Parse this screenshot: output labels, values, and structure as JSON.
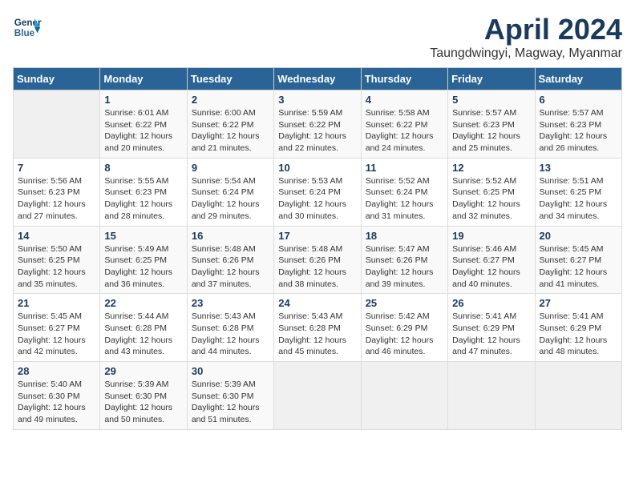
{
  "header": {
    "logo_line1": "General",
    "logo_line2": "Blue",
    "month_title": "April 2024",
    "subtitle": "Taungdwingyi, Magway, Myanmar"
  },
  "calendar": {
    "days_of_week": [
      "Sunday",
      "Monday",
      "Tuesday",
      "Wednesday",
      "Thursday",
      "Friday",
      "Saturday"
    ],
    "weeks": [
      [
        {
          "day": "",
          "info": ""
        },
        {
          "day": "1",
          "info": "Sunrise: 6:01 AM\nSunset: 6:22 PM\nDaylight: 12 hours\nand 20 minutes."
        },
        {
          "day": "2",
          "info": "Sunrise: 6:00 AM\nSunset: 6:22 PM\nDaylight: 12 hours\nand 21 minutes."
        },
        {
          "day": "3",
          "info": "Sunrise: 5:59 AM\nSunset: 6:22 PM\nDaylight: 12 hours\nand 22 minutes."
        },
        {
          "day": "4",
          "info": "Sunrise: 5:58 AM\nSunset: 6:22 PM\nDaylight: 12 hours\nand 24 minutes."
        },
        {
          "day": "5",
          "info": "Sunrise: 5:57 AM\nSunset: 6:23 PM\nDaylight: 12 hours\nand 25 minutes."
        },
        {
          "day": "6",
          "info": "Sunrise: 5:57 AM\nSunset: 6:23 PM\nDaylight: 12 hours\nand 26 minutes."
        }
      ],
      [
        {
          "day": "7",
          "info": "Sunrise: 5:56 AM\nSunset: 6:23 PM\nDaylight: 12 hours\nand 27 minutes."
        },
        {
          "day": "8",
          "info": "Sunrise: 5:55 AM\nSunset: 6:23 PM\nDaylight: 12 hours\nand 28 minutes."
        },
        {
          "day": "9",
          "info": "Sunrise: 5:54 AM\nSunset: 6:24 PM\nDaylight: 12 hours\nand 29 minutes."
        },
        {
          "day": "10",
          "info": "Sunrise: 5:53 AM\nSunset: 6:24 PM\nDaylight: 12 hours\nand 30 minutes."
        },
        {
          "day": "11",
          "info": "Sunrise: 5:52 AM\nSunset: 6:24 PM\nDaylight: 12 hours\nand 31 minutes."
        },
        {
          "day": "12",
          "info": "Sunrise: 5:52 AM\nSunset: 6:25 PM\nDaylight: 12 hours\nand 32 minutes."
        },
        {
          "day": "13",
          "info": "Sunrise: 5:51 AM\nSunset: 6:25 PM\nDaylight: 12 hours\nand 34 minutes."
        }
      ],
      [
        {
          "day": "14",
          "info": "Sunrise: 5:50 AM\nSunset: 6:25 PM\nDaylight: 12 hours\nand 35 minutes."
        },
        {
          "day": "15",
          "info": "Sunrise: 5:49 AM\nSunset: 6:25 PM\nDaylight: 12 hours\nand 36 minutes."
        },
        {
          "day": "16",
          "info": "Sunrise: 5:48 AM\nSunset: 6:26 PM\nDaylight: 12 hours\nand 37 minutes."
        },
        {
          "day": "17",
          "info": "Sunrise: 5:48 AM\nSunset: 6:26 PM\nDaylight: 12 hours\nand 38 minutes."
        },
        {
          "day": "18",
          "info": "Sunrise: 5:47 AM\nSunset: 6:26 PM\nDaylight: 12 hours\nand 39 minutes."
        },
        {
          "day": "19",
          "info": "Sunrise: 5:46 AM\nSunset: 6:27 PM\nDaylight: 12 hours\nand 40 minutes."
        },
        {
          "day": "20",
          "info": "Sunrise: 5:45 AM\nSunset: 6:27 PM\nDaylight: 12 hours\nand 41 minutes."
        }
      ],
      [
        {
          "day": "21",
          "info": "Sunrise: 5:45 AM\nSunset: 6:27 PM\nDaylight: 12 hours\nand 42 minutes."
        },
        {
          "day": "22",
          "info": "Sunrise: 5:44 AM\nSunset: 6:28 PM\nDaylight: 12 hours\nand 43 minutes."
        },
        {
          "day": "23",
          "info": "Sunrise: 5:43 AM\nSunset: 6:28 PM\nDaylight: 12 hours\nand 44 minutes."
        },
        {
          "day": "24",
          "info": "Sunrise: 5:43 AM\nSunset: 6:28 PM\nDaylight: 12 hours\nand 45 minutes."
        },
        {
          "day": "25",
          "info": "Sunrise: 5:42 AM\nSunset: 6:29 PM\nDaylight: 12 hours\nand 46 minutes."
        },
        {
          "day": "26",
          "info": "Sunrise: 5:41 AM\nSunset: 6:29 PM\nDaylight: 12 hours\nand 47 minutes."
        },
        {
          "day": "27",
          "info": "Sunrise: 5:41 AM\nSunset: 6:29 PM\nDaylight: 12 hours\nand 48 minutes."
        }
      ],
      [
        {
          "day": "28",
          "info": "Sunrise: 5:40 AM\nSunset: 6:30 PM\nDaylight: 12 hours\nand 49 minutes."
        },
        {
          "day": "29",
          "info": "Sunrise: 5:39 AM\nSunset: 6:30 PM\nDaylight: 12 hours\nand 50 minutes."
        },
        {
          "day": "30",
          "info": "Sunrise: 5:39 AM\nSunset: 6:30 PM\nDaylight: 12 hours\nand 51 minutes."
        },
        {
          "day": "",
          "info": ""
        },
        {
          "day": "",
          "info": ""
        },
        {
          "day": "",
          "info": ""
        },
        {
          "day": "",
          "info": ""
        }
      ]
    ]
  }
}
